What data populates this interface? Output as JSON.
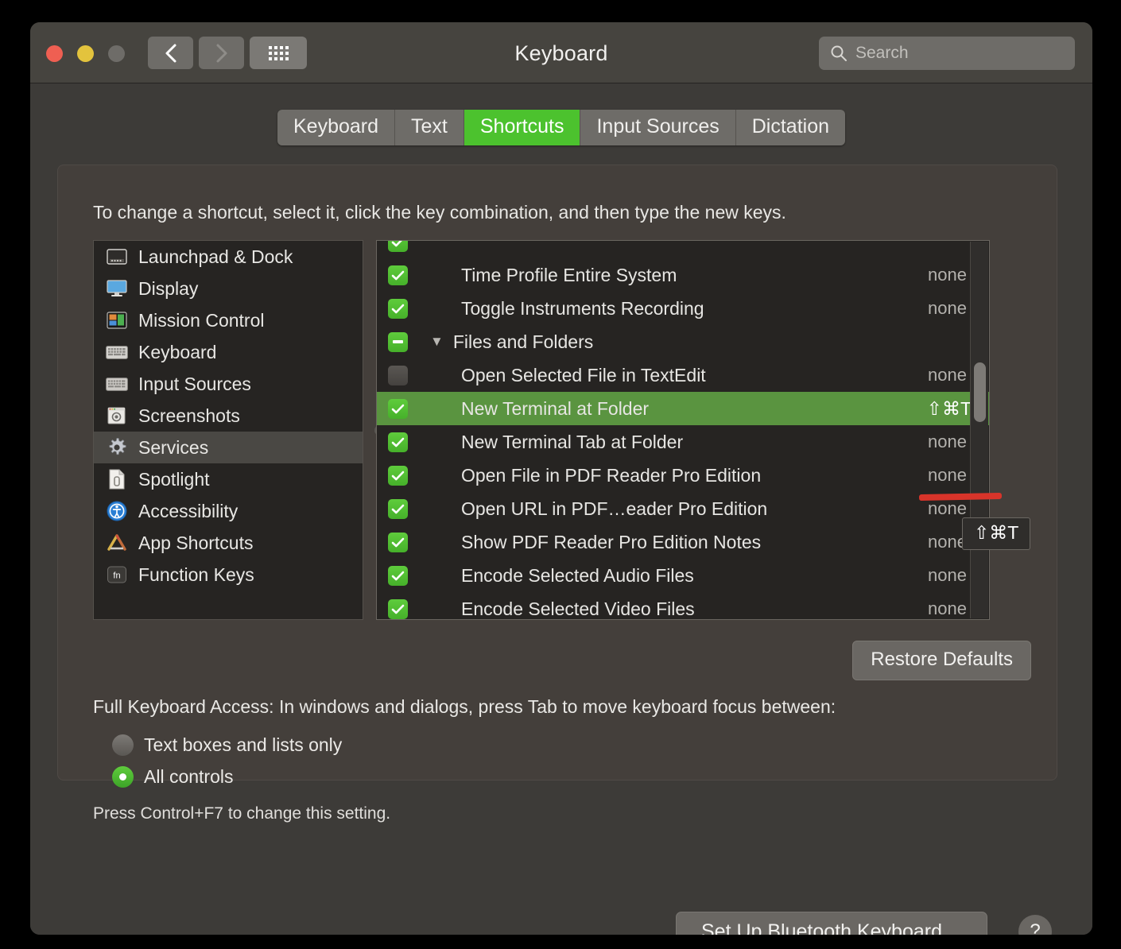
{
  "window": {
    "title": "Keyboard",
    "traffic_lights": [
      "close",
      "minimize",
      "zoom"
    ],
    "back_icon": "chevron-left-icon",
    "forward_icon": "chevron-right-icon",
    "grid_icon": "show-all-grid-icon"
  },
  "search": {
    "placeholder": "Search",
    "icon": "search-icon"
  },
  "tabs": [
    {
      "label": "Keyboard",
      "active": false
    },
    {
      "label": "Text",
      "active": false
    },
    {
      "label": "Shortcuts",
      "active": true
    },
    {
      "label": "Input Sources",
      "active": false
    },
    {
      "label": "Dictation",
      "active": false
    }
  ],
  "panel": {
    "hint": "To change a shortcut, select it, click the key combination, and then type the new keys."
  },
  "sidebar": {
    "items": [
      {
        "label": "Launchpad & Dock",
        "icon": "launchpad-dock-icon",
        "selected": false
      },
      {
        "label": "Display",
        "icon": "display-icon",
        "selected": false
      },
      {
        "label": "Mission Control",
        "icon": "mission-control-icon",
        "selected": false
      },
      {
        "label": "Keyboard",
        "icon": "keyboard-icon",
        "selected": false
      },
      {
        "label": "Input Sources",
        "icon": "input-sources-icon",
        "selected": false
      },
      {
        "label": "Screenshots",
        "icon": "screenshots-icon",
        "selected": false
      },
      {
        "label": "Services",
        "icon": "services-gear-icon",
        "selected": true
      },
      {
        "label": "Spotlight",
        "icon": "spotlight-document-icon",
        "selected": false
      },
      {
        "label": "Accessibility",
        "icon": "accessibility-icon",
        "selected": false
      },
      {
        "label": "App Shortcuts",
        "icon": "app-shortcuts-icon",
        "selected": false
      },
      {
        "label": "Function Keys",
        "icon": "function-keys-icon",
        "selected": false
      }
    ]
  },
  "shortcuts": {
    "rows": [
      {
        "label": "",
        "shortcut": "",
        "checkbox": "on",
        "type": "clipped",
        "selected": false
      },
      {
        "label": "Time Profile Entire System",
        "shortcut": "none",
        "checkbox": "on",
        "type": "item",
        "selected": false
      },
      {
        "label": "Toggle Instruments Recording",
        "shortcut": "none",
        "checkbox": "on",
        "type": "item",
        "selected": false
      },
      {
        "label": "Files and Folders",
        "shortcut": "",
        "checkbox": "mixed",
        "type": "group",
        "disclosure": "▼",
        "selected": false
      },
      {
        "label": "Open Selected File in TextEdit",
        "shortcut": "none",
        "checkbox": "off",
        "type": "item",
        "selected": false
      },
      {
        "label": "New Terminal at Folder",
        "shortcut": "⇧⌘T",
        "checkbox": "on",
        "type": "item",
        "selected": true
      },
      {
        "label": "New Terminal Tab at Folder",
        "shortcut": "none",
        "checkbox": "on",
        "type": "item",
        "selected": false
      },
      {
        "label": "Open File in PDF Reader Pro Edition",
        "shortcut": "none",
        "checkbox": "on",
        "type": "item",
        "selected": false
      },
      {
        "label": "Open URL in PDF…eader Pro Edition",
        "shortcut": "none",
        "checkbox": "on",
        "type": "item",
        "selected": false
      },
      {
        "label": "Show PDF Reader Pro Edition Notes",
        "shortcut": "none",
        "checkbox": "on",
        "type": "item",
        "selected": false
      },
      {
        "label": "Encode Selected Audio Files",
        "shortcut": "none",
        "checkbox": "on",
        "type": "item",
        "selected": false
      },
      {
        "label": "Encode Selected Video Files",
        "shortcut": "none",
        "checkbox": "on",
        "type": "item",
        "selected": false
      }
    ],
    "tooltip": "⇧⌘T"
  },
  "buttons": {
    "restore_defaults": "Restore Defaults",
    "set_up_bluetooth": "Set Up Bluetooth Keyboard…",
    "help": "?"
  },
  "full_keyboard_access": {
    "title": "Full Keyboard Access: In windows and dialogs, press Tab to move keyboard focus between:",
    "options": [
      {
        "label": "Text boxes and lists only",
        "selected": false
      },
      {
        "label": "All controls",
        "selected": true
      }
    ],
    "note": "Press Control+F7 to change this setting."
  },
  "colors": {
    "accent_green": "#4cc22e",
    "selection_green": "#5a9440",
    "annotation_red": "#d8342a",
    "window_bg": "#3d3b38",
    "list_bg": "#262422"
  }
}
